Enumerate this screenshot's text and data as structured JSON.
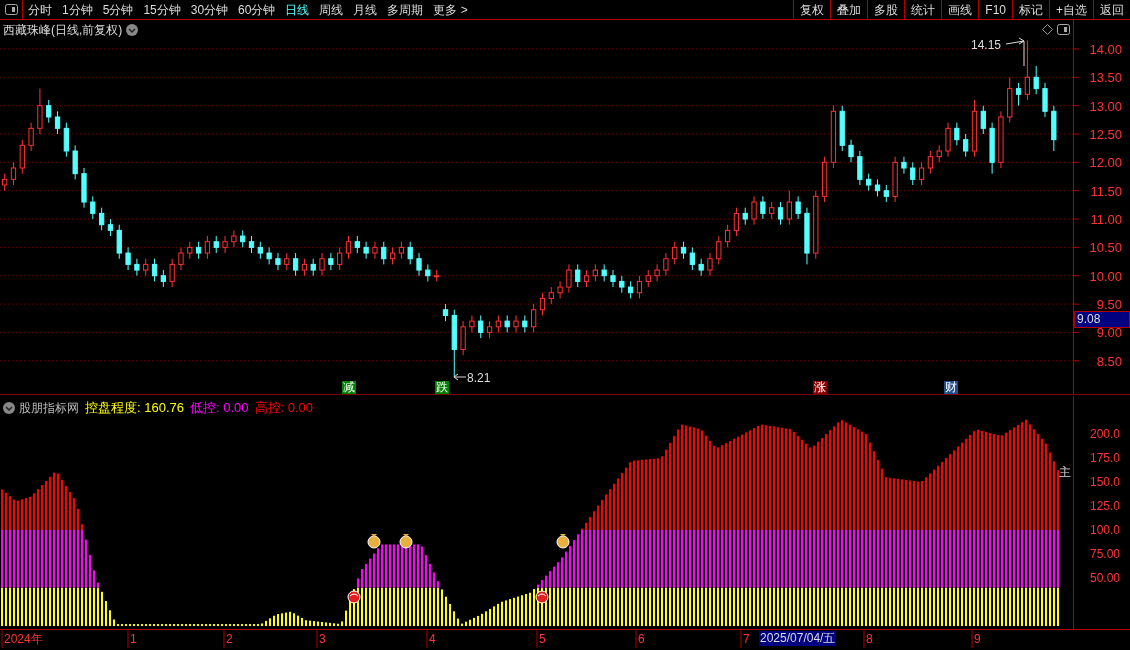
{
  "toolbar": {
    "tabs": [
      {
        "label": "分时",
        "selected": false
      },
      {
        "label": "1分钟",
        "selected": false
      },
      {
        "label": "5分钟",
        "selected": false
      },
      {
        "label": "15分钟",
        "selected": false
      },
      {
        "label": "30分钟",
        "selected": false
      },
      {
        "label": "60分钟",
        "selected": false
      },
      {
        "label": "日线",
        "selected": true
      },
      {
        "label": "周线",
        "selected": false
      },
      {
        "label": "月线",
        "selected": false
      },
      {
        "label": "多周期",
        "selected": false
      },
      {
        "label": "更多 >",
        "selected": false
      }
    ],
    "buttons": [
      "复权",
      "叠加",
      "多股",
      "统计",
      "画线",
      "F10",
      "标记",
      "+自选",
      "返回"
    ]
  },
  "price_panel": {
    "title": "西藏珠峰(日线,前复权)",
    "high_label": "14.15",
    "low_label": "8.21",
    "signals": [
      {
        "label": "减",
        "color": "#008000"
      },
      {
        "label": "跌",
        "color": "#008000"
      },
      {
        "label": "涨",
        "color": "#8b0000"
      },
      {
        "label": "财",
        "color": "#1f4e8c"
      }
    ],
    "price_tag": "9.08",
    "chart_data": {
      "type": "candlestick",
      "ylim": [
        7.9,
        14.5
      ],
      "grid": true,
      "yticks": [
        {
          "value": 14,
          "label": "14.00"
        },
        {
          "value": 13.5,
          "label": "13.50"
        },
        {
          "value": 13,
          "label": "13.00"
        },
        {
          "value": 12.5,
          "label": "12.50"
        },
        {
          "value": 12,
          "label": "12.00"
        },
        {
          "value": 11.5,
          "label": "11.50"
        },
        {
          "value": 11,
          "label": "11.00"
        },
        {
          "value": 10.5,
          "label": "10.50"
        },
        {
          "value": 10,
          "label": "10.00"
        },
        {
          "value": 9.5,
          "label": "9.50"
        },
        {
          "value": 9,
          "label": "9.00"
        },
        {
          "value": 8.5,
          "label": "8.50"
        }
      ],
      "ohlc": [
        [
          11.6,
          11.8,
          11.5,
          11.7
        ],
        [
          11.7,
          12.0,
          11.6,
          11.9
        ],
        [
          11.9,
          12.4,
          11.8,
          12.3
        ],
        [
          12.3,
          12.7,
          12.2,
          12.6
        ],
        [
          12.6,
          13.3,
          12.5,
          13.0
        ],
        [
          13.0,
          13.1,
          12.7,
          12.8
        ],
        [
          12.8,
          12.9,
          12.5,
          12.6
        ],
        [
          12.6,
          12.7,
          12.1,
          12.2
        ],
        [
          12.2,
          12.3,
          11.7,
          11.8
        ],
        [
          11.8,
          11.9,
          11.2,
          11.3
        ],
        [
          11.3,
          11.4,
          11.0,
          11.1
        ],
        [
          11.1,
          11.2,
          10.8,
          10.9
        ],
        [
          10.9,
          11.0,
          10.7,
          10.8
        ],
        [
          10.8,
          10.9,
          10.3,
          10.4
        ],
        [
          10.4,
          10.5,
          10.1,
          10.2
        ],
        [
          10.2,
          10.3,
          10.0,
          10.1
        ],
        [
          10.1,
          10.3,
          10.0,
          10.2
        ],
        [
          10.2,
          10.3,
          9.9,
          10.0
        ],
        [
          10.0,
          10.1,
          9.8,
          9.9
        ],
        [
          9.9,
          10.3,
          9.8,
          10.2
        ],
        [
          10.2,
          10.5,
          10.1,
          10.4
        ],
        [
          10.4,
          10.6,
          10.3,
          10.5
        ],
        [
          10.5,
          10.6,
          10.3,
          10.4
        ],
        [
          10.4,
          10.7,
          10.3,
          10.6
        ],
        [
          10.6,
          10.7,
          10.4,
          10.5
        ],
        [
          10.5,
          10.7,
          10.4,
          10.6
        ],
        [
          10.6,
          10.8,
          10.5,
          10.7
        ],
        [
          10.7,
          10.8,
          10.5,
          10.6
        ],
        [
          10.6,
          10.7,
          10.4,
          10.5
        ],
        [
          10.5,
          10.6,
          10.3,
          10.4
        ],
        [
          10.4,
          10.5,
          10.2,
          10.3
        ],
        [
          10.3,
          10.4,
          10.1,
          10.2
        ],
        [
          10.2,
          10.4,
          10.1,
          10.3
        ],
        [
          10.3,
          10.4,
          10.0,
          10.1
        ],
        [
          10.1,
          10.3,
          10.0,
          10.2
        ],
        [
          10.2,
          10.3,
          10.0,
          10.1
        ],
        [
          10.1,
          10.4,
          10.0,
          10.3
        ],
        [
          10.3,
          10.4,
          10.1,
          10.2
        ],
        [
          10.2,
          10.5,
          10.1,
          10.4
        ],
        [
          10.4,
          10.7,
          10.3,
          10.6
        ],
        [
          10.6,
          10.7,
          10.4,
          10.5
        ],
        [
          10.5,
          10.6,
          10.3,
          10.4
        ],
        [
          10.4,
          10.6,
          10.3,
          10.5
        ],
        [
          10.5,
          10.6,
          10.2,
          10.3
        ],
        [
          10.3,
          10.5,
          10.2,
          10.4
        ],
        [
          10.4,
          10.6,
          10.3,
          10.5
        ],
        [
          10.5,
          10.6,
          10.2,
          10.3
        ],
        [
          10.3,
          10.4,
          10.0,
          10.1
        ],
        [
          10.1,
          10.2,
          9.9,
          10.0
        ],
        [
          10.0,
          10.1,
          9.9,
          10.0
        ],
        [
          9.4,
          9.5,
          9.2,
          9.3
        ],
        [
          9.3,
          9.4,
          8.21,
          8.7
        ],
        [
          8.7,
          9.2,
          8.6,
          9.1
        ],
        [
          9.1,
          9.3,
          9.0,
          9.2
        ],
        [
          9.2,
          9.3,
          8.9,
          9.0
        ],
        [
          9.0,
          9.2,
          8.9,
          9.1
        ],
        [
          9.1,
          9.3,
          9.0,
          9.2
        ],
        [
          9.2,
          9.3,
          9.0,
          9.1
        ],
        [
          9.1,
          9.3,
          9.0,
          9.2
        ],
        [
          9.2,
          9.3,
          9.0,
          9.1
        ],
        [
          9.1,
          9.5,
          9.0,
          9.4
        ],
        [
          9.4,
          9.7,
          9.3,
          9.6
        ],
        [
          9.6,
          9.8,
          9.5,
          9.7
        ],
        [
          9.7,
          9.9,
          9.6,
          9.8
        ],
        [
          9.8,
          10.2,
          9.7,
          10.1
        ],
        [
          10.1,
          10.2,
          9.8,
          9.9
        ],
        [
          9.9,
          10.1,
          9.8,
          10.0
        ],
        [
          10.0,
          10.2,
          9.9,
          10.1
        ],
        [
          10.1,
          10.2,
          9.9,
          10.0
        ],
        [
          10.0,
          10.1,
          9.8,
          9.9
        ],
        [
          9.9,
          10.0,
          9.7,
          9.8
        ],
        [
          9.8,
          9.9,
          9.6,
          9.7
        ],
        [
          9.7,
          10.0,
          9.6,
          9.9
        ],
        [
          9.9,
          10.1,
          9.8,
          10.0
        ],
        [
          10.0,
          10.2,
          9.9,
          10.1
        ],
        [
          10.1,
          10.4,
          10.0,
          10.3
        ],
        [
          10.3,
          10.6,
          10.2,
          10.5
        ],
        [
          10.5,
          10.6,
          10.3,
          10.4
        ],
        [
          10.4,
          10.5,
          10.1,
          10.2
        ],
        [
          10.2,
          10.3,
          10.0,
          10.1
        ],
        [
          10.1,
          10.4,
          10.0,
          10.3
        ],
        [
          10.3,
          10.7,
          10.2,
          10.6
        ],
        [
          10.6,
          10.9,
          10.5,
          10.8
        ],
        [
          10.8,
          11.2,
          10.7,
          11.1
        ],
        [
          11.1,
          11.2,
          10.9,
          11.0
        ],
        [
          11.0,
          11.4,
          10.9,
          11.3
        ],
        [
          11.3,
          11.4,
          11.0,
          11.1
        ],
        [
          11.1,
          11.3,
          11.0,
          11.2
        ],
        [
          11.2,
          11.3,
          10.9,
          11.0
        ],
        [
          11.0,
          11.5,
          10.9,
          11.3
        ],
        [
          11.3,
          11.4,
          11.0,
          11.1
        ],
        [
          11.1,
          11.2,
          10.2,
          10.4
        ],
        [
          10.4,
          11.5,
          10.3,
          11.4
        ],
        [
          11.4,
          12.1,
          11.3,
          12.0
        ],
        [
          12.0,
          13.0,
          11.9,
          12.9
        ],
        [
          12.9,
          13.0,
          12.2,
          12.3
        ],
        [
          12.3,
          12.4,
          12.0,
          12.1
        ],
        [
          12.1,
          12.2,
          11.6,
          11.7
        ],
        [
          11.7,
          11.8,
          11.5,
          11.6
        ],
        [
          11.6,
          11.7,
          11.4,
          11.5
        ],
        [
          11.5,
          11.6,
          11.3,
          11.4
        ],
        [
          11.4,
          12.1,
          11.3,
          12.0
        ],
        [
          12.0,
          12.1,
          11.8,
          11.9
        ],
        [
          11.9,
          12.0,
          11.6,
          11.7
        ],
        [
          11.7,
          12.0,
          11.6,
          11.9
        ],
        [
          11.9,
          12.2,
          11.8,
          12.1
        ],
        [
          12.1,
          12.3,
          12.0,
          12.2
        ],
        [
          12.2,
          12.7,
          12.1,
          12.6
        ],
        [
          12.6,
          12.7,
          12.3,
          12.4
        ],
        [
          12.4,
          12.5,
          12.1,
          12.2
        ],
        [
          12.2,
          13.1,
          12.1,
          12.9
        ],
        [
          12.9,
          13.0,
          12.5,
          12.6
        ],
        [
          12.6,
          12.7,
          11.8,
          12.0
        ],
        [
          12.0,
          12.9,
          11.9,
          12.8
        ],
        [
          12.8,
          13.5,
          12.7,
          13.3
        ],
        [
          13.3,
          13.4,
          13.0,
          13.2
        ],
        [
          13.2,
          14.15,
          13.1,
          13.5
        ],
        [
          13.5,
          13.7,
          13.2,
          13.3
        ],
        [
          13.3,
          13.4,
          12.8,
          12.9
        ],
        [
          12.9,
          13.0,
          12.2,
          12.4
        ]
      ]
    }
  },
  "indicator_panel": {
    "name": "股朋指标网",
    "readings": [
      {
        "label": "控盘程度:",
        "value": "160.76",
        "color": "#ffff00"
      },
      {
        "label": "低控:",
        "value": "0.00",
        "color": "#ff00ff"
      },
      {
        "label": "高控:",
        "value": "0.00",
        "color": "#ff0000"
      }
    ],
    "side_label": "主",
    "axis_labels": [
      "200.0",
      "175.0",
      "150.0",
      "125.0",
      "100.0",
      "75.00",
      "50.00"
    ]
  },
  "date_axis": {
    "labels": [
      "2024年",
      "1",
      "2",
      "3",
      "4",
      "5",
      "6",
      "7",
      "8",
      "9"
    ],
    "cursor_date": "2025/07/04/五"
  }
}
